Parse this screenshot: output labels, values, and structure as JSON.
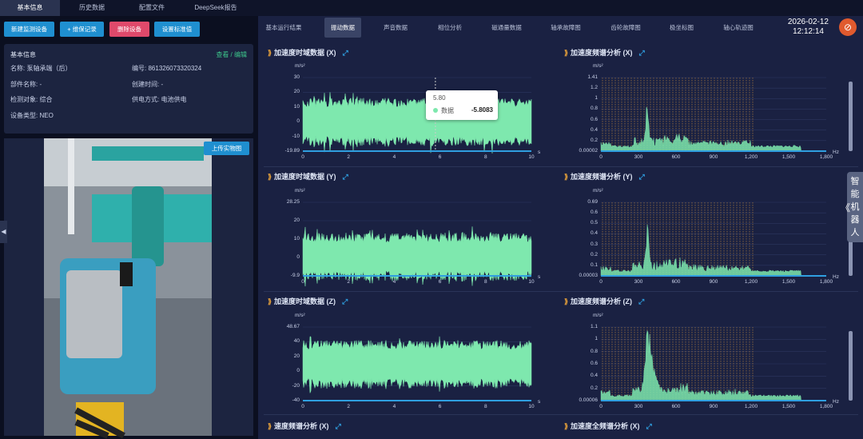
{
  "top_tabs": [
    "基本信息",
    "历史数据",
    "配置文件",
    "DeepSeek报告"
  ],
  "left_buttons": [
    {
      "label": "新建监测设备",
      "color": "#1f8fd0"
    },
    {
      "label": "+ 维保记录",
      "color": "#1f8fd0"
    },
    {
      "label": "删除设备",
      "color": "#e0496b"
    },
    {
      "label": "设置标准值",
      "color": "#1f8fd0"
    }
  ],
  "info": {
    "title": "基本信息",
    "action": "查看 / 编辑",
    "fields": [
      {
        "label": "名称:",
        "value": "泵轴承端（后）"
      },
      {
        "label": "编号:",
        "value": "861326073320324"
      },
      {
        "label": "部件名称:",
        "value": "-"
      },
      {
        "label": "创建时间:",
        "value": "-"
      },
      {
        "label": "检测对象:",
        "value": "综合"
      },
      {
        "label": "供电方式:",
        "value": "电池供电"
      },
      {
        "label": "设备类型:",
        "value": "NEO"
      }
    ]
  },
  "upload_button": "上传实物图",
  "sub_tabs": [
    "基本运行结果",
    "振动数据",
    "声音数据",
    "相位分析",
    "磁通量数据",
    "轴承故障图",
    "齿轮故障图",
    "极坐标图",
    "轴心轨迹图"
  ],
  "active_sub_tab": 1,
  "datetime": {
    "date": "2026-02-12",
    "time": "12:12:14"
  },
  "robot_label": [
    "智",
    "能",
    "机",
    "器",
    "人"
  ],
  "colors": {
    "accent": "#2f9fe0",
    "series": "#7ee8ae",
    "alert": "#e05a2e",
    "marker": "#e8a23a"
  },
  "tooltip": {
    "x": "5.80",
    "name": "数据",
    "value": "-5.8083"
  },
  "chart_data": [
    {
      "title": "加速度时域数据",
      "axis": "(X)",
      "type": "area",
      "yunit": "m/s²",
      "xunit": "s",
      "x": [
        0,
        10
      ],
      "xticks": [
        "0",
        "2",
        "4",
        "6",
        "8",
        "10"
      ],
      "yticks": [
        "30",
        "20",
        "10",
        "0",
        "-10",
        "-19.89"
      ],
      "ylim": [
        -19.89,
        30
      ]
    },
    {
      "title": "加速度频谱分析",
      "axis": "(X)",
      "type": "area",
      "yunit": "m/s²",
      "xunit": "Hz",
      "x": [
        0,
        1800
      ],
      "xticks": [
        "0",
        "300",
        "600",
        "900",
        "1,200",
        "1,500",
        "1,800"
      ],
      "yticks": [
        "1.41",
        "1.2",
        "1",
        "0.8",
        "0.6",
        "0.4",
        "0.2",
        "0.00002"
      ],
      "ylim": [
        0,
        1.41
      ]
    },
    {
      "title": "加速度时域数据",
      "axis": "(Y)",
      "type": "area",
      "yunit": "m/s²",
      "xunit": "s",
      "x": [
        0,
        10
      ],
      "xticks": [
        "0",
        "2",
        "4",
        "6",
        "8",
        "10"
      ],
      "yticks": [
        "28.25",
        "20",
        "10",
        "0",
        "-9.9"
      ],
      "ylim": [
        -9.9,
        28.25
      ]
    },
    {
      "title": "加速度频谱分析",
      "axis": "(Y)",
      "type": "area",
      "yunit": "m/s²",
      "xunit": "Hz",
      "x": [
        0,
        1800
      ],
      "xticks": [
        "0",
        "300",
        "600",
        "900",
        "1,200",
        "1,500",
        "1,800"
      ],
      "yticks": [
        "0.69",
        "0.6",
        "0.5",
        "0.4",
        "0.3",
        "0.2",
        "0.1",
        "0.00003"
      ],
      "ylim": [
        0,
        0.69
      ]
    },
    {
      "title": "加速度时域数据",
      "axis": "(Z)",
      "type": "area",
      "yunit": "m/s²",
      "xunit": "s",
      "x": [
        0,
        10
      ],
      "xticks": [
        "0",
        "2",
        "4",
        "6",
        "8",
        "10"
      ],
      "yticks": [
        "48.67",
        "40",
        "20",
        "0",
        "-20",
        "-40"
      ],
      "ylim": [
        -48,
        48.67
      ]
    },
    {
      "title": "加速度频谱分析",
      "axis": "(Z)",
      "type": "area",
      "yunit": "m/s²",
      "xunit": "Hz",
      "x": [
        0,
        1800
      ],
      "xticks": [
        "0",
        "300",
        "600",
        "900",
        "1,200",
        "1,500",
        "1,800"
      ],
      "yticks": [
        "1.1",
        "1",
        "0.8",
        "0.6",
        "0.4",
        "0.2",
        "0.00006"
      ],
      "ylim": [
        0,
        1.1
      ]
    }
  ],
  "bottom_titles": [
    {
      "title": "速度频谱分析",
      "axis": "(X)"
    },
    {
      "title": "加速度全频谱分析",
      "axis": "(X)"
    }
  ]
}
